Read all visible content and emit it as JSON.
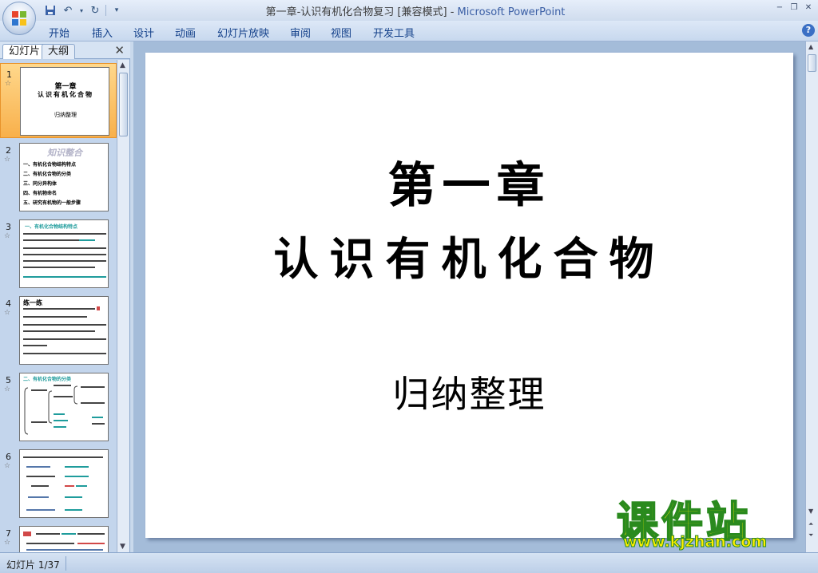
{
  "window": {
    "doc_title": "第一章-认识有机化合物复习 [兼容模式] - ",
    "app_name": "Microsoft PowerPoint"
  },
  "ribbon": {
    "tabs": [
      "开始",
      "插入",
      "设计",
      "动画",
      "幻灯片放映",
      "审阅",
      "视图",
      "开发工具"
    ]
  },
  "left_pane": {
    "tab_slides": "幻灯片",
    "tab_outline": "大纲",
    "thumbnails": [
      {
        "number": "1",
        "selected": true,
        "title": "第一章",
        "subtitle": "认识有机化合物",
        "note": "归纳整理"
      },
      {
        "number": "2",
        "selected": false,
        "title": "知识整合",
        "lines": [
          "一、有机化合物结构特点",
          "二、有机化合物的分类",
          "三、同分异构体",
          "四、有机物命名",
          "五、研究有机物的一般步骤"
        ]
      },
      {
        "number": "3",
        "selected": false,
        "title": "一、有机化合物结构特点"
      },
      {
        "number": "4",
        "selected": false,
        "title": "练一练"
      },
      {
        "number": "5",
        "selected": false,
        "title": "二、有机化合物的分类"
      },
      {
        "number": "6",
        "selected": false,
        "title": ""
      },
      {
        "number": "7",
        "selected": false,
        "title": ""
      }
    ]
  },
  "slide": {
    "line1": "第一章",
    "line2": "认识有机化合物",
    "line3": "归纳整理"
  },
  "watermark": {
    "cn": "课件站",
    "url": "www.kjzhan.com"
  },
  "status": {
    "slide_counter": "幻灯片 1/37"
  }
}
